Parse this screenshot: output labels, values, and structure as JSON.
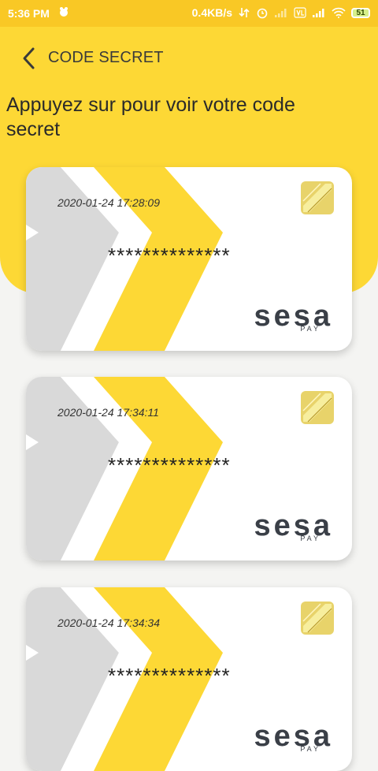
{
  "status_bar": {
    "time": "5:36 PM",
    "network_speed": "0.4KB/s",
    "battery_level": "51"
  },
  "header": {
    "title": "CODE SECRET",
    "back_icon": "chevron-left-icon"
  },
  "instruction": "Appuyez sur pour voir votre code secret",
  "cards": [
    {
      "date": "2020-01-24 17:28:09",
      "code": "**************",
      "logo": "sesa",
      "logo_sub": "PAY"
    },
    {
      "date": "2020-01-24 17:34:11",
      "code": "**************",
      "logo": "sesa",
      "logo_sub": "PAY"
    },
    {
      "date": "2020-01-24 17:34:34",
      "code": "**************",
      "logo": "sesa",
      "logo_sub": "PAY"
    }
  ],
  "colors": {
    "accent_yellow": "#fdd835",
    "status_bar_yellow": "#f9c825",
    "card_gray": "#d9d9d9",
    "text_dark": "#222222",
    "logo_gray": "#3a3f47"
  }
}
